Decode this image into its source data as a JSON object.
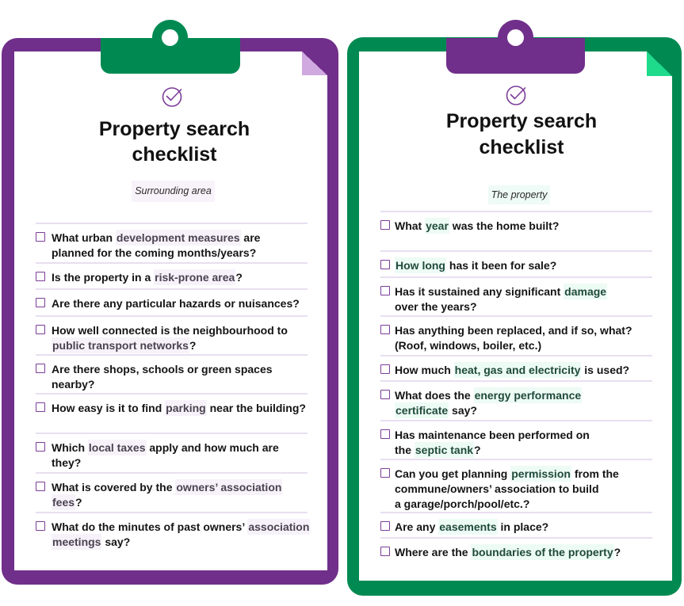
{
  "colors": {
    "purple": "#702f8a",
    "green": "#008a52",
    "lilac": "#d1a9e1",
    "mint": "#1edb8c",
    "checkbox": "#7b3c98"
  },
  "panels": [
    {
      "theme": "purple",
      "icon": "check-circle-icon",
      "title": [
        "Property search",
        "checklist"
      ],
      "section": "Surrounding area",
      "items": [
        {
          "checked": false,
          "lines": [
            [
              {
                "text": "What urban "
              },
              {
                "text": "development measures",
                "highlight": true
              },
              {
                "text": " are"
              }
            ],
            [
              {
                "text": "planned for the coming months/years?"
              }
            ]
          ]
        },
        {
          "checked": false,
          "lines": [
            [
              {
                "text": "Is the property in a "
              },
              {
                "text": "risk-prone area",
                "highlight": true
              },
              {
                "text": "?"
              }
            ]
          ]
        },
        {
          "checked": false,
          "lines": [
            [
              {
                "text": "Are there any particular hazards or nuisances?"
              }
            ]
          ]
        },
        {
          "checked": false,
          "lines": [
            [
              {
                "text": "How well connected is the neighbourhood to"
              }
            ],
            [
              {
                "text": "public transport networks",
                "highlight": true
              },
              {
                "text": "?"
              }
            ]
          ]
        },
        {
          "checked": false,
          "lines": [
            [
              {
                "text": "Are there shops, schools or green spaces"
              }
            ],
            [
              {
                "text": "nearby?"
              }
            ]
          ]
        },
        {
          "checked": false,
          "lines": [
            [
              {
                "text": "How easy is it to find "
              },
              {
                "text": "parking",
                "highlight": true
              },
              {
                "text": " near the building?"
              }
            ]
          ]
        },
        {
          "checked": false,
          "lines": [
            [
              {
                "text": "Which "
              },
              {
                "text": "local taxes",
                "highlight": true
              },
              {
                "text": " apply and how much are"
              }
            ],
            [
              {
                "text": "they?"
              }
            ]
          ]
        },
        {
          "checked": false,
          "lines": [
            [
              {
                "text": "What is covered by the "
              },
              {
                "text": "owners’ association ",
                "highlight": true
              }
            ],
            [
              {
                "text": "fees",
                "highlight": true
              },
              {
                "text": "?"
              }
            ]
          ]
        },
        {
          "checked": false,
          "lines": [
            [
              {
                "text": "What do the minutes of past owners’ "
              },
              {
                "text": "association",
                "highlight": true
              }
            ],
            [
              {
                "text": "meetings",
                "highlight": true
              },
              {
                "text": " say?"
              }
            ]
          ]
        }
      ]
    },
    {
      "theme": "green",
      "icon": "check-circle-icon",
      "title": [
        "Property search",
        "checklist"
      ],
      "section": "The property",
      "items": [
        {
          "checked": false,
          "lines": [
            [
              {
                "text": "What "
              },
              {
                "text": "year",
                "highlight": true
              },
              {
                "text": " was the home built?"
              }
            ]
          ]
        },
        {
          "checked": false,
          "lines": [
            [
              {
                "text": "How long",
                "highlight": true
              },
              {
                "text": " has it been for sale?"
              }
            ]
          ]
        },
        {
          "checked": false,
          "lines": [
            [
              {
                "text": "Has it sustained any significant "
              },
              {
                "text": "damage",
                "highlight": true
              }
            ],
            [
              {
                "text": "over the years?"
              }
            ]
          ]
        },
        {
          "checked": false,
          "lines": [
            [
              {
                "text": "Has anything been replaced, and if so, what?"
              }
            ],
            [
              {
                "text": "(Roof, windows, boiler, etc.)"
              }
            ]
          ]
        },
        {
          "checked": false,
          "lines": [
            [
              {
                "text": "How much "
              },
              {
                "text": "heat, gas and electricity",
                "highlight": true
              },
              {
                "text": " is used?"
              }
            ]
          ]
        },
        {
          "checked": false,
          "lines": [
            [
              {
                "text": "What does the "
              },
              {
                "text": "energy performance",
                "highlight": true
              }
            ],
            [
              {
                "text": "certificate",
                "highlight": true
              },
              {
                "text": " say?"
              }
            ]
          ]
        },
        {
          "checked": false,
          "lines": [
            [
              {
                "text": "Has maintenance been performed on"
              }
            ],
            [
              {
                "text": "the "
              },
              {
                "text": "septic tank",
                "highlight": true
              },
              {
                "text": "?"
              }
            ]
          ]
        },
        {
          "checked": false,
          "lines": [
            [
              {
                "text": "Can you get planning "
              },
              {
                "text": "permission",
                "highlight": true
              },
              {
                "text": " from the"
              }
            ],
            [
              {
                "text": "commune/owners’ association to build"
              }
            ],
            [
              {
                "text": "a garage/porch/pool/etc.?"
              }
            ]
          ]
        },
        {
          "checked": false,
          "lines": [
            [
              {
                "text": "Are any "
              },
              {
                "text": "easements",
                "highlight": true
              },
              {
                "text": " in place?"
              }
            ]
          ]
        },
        {
          "checked": false,
          "lines": [
            [
              {
                "text": "Where are the "
              },
              {
                "text": "boundaries of the property",
                "highlight": true
              },
              {
                "text": "?"
              }
            ]
          ]
        }
      ]
    }
  ]
}
